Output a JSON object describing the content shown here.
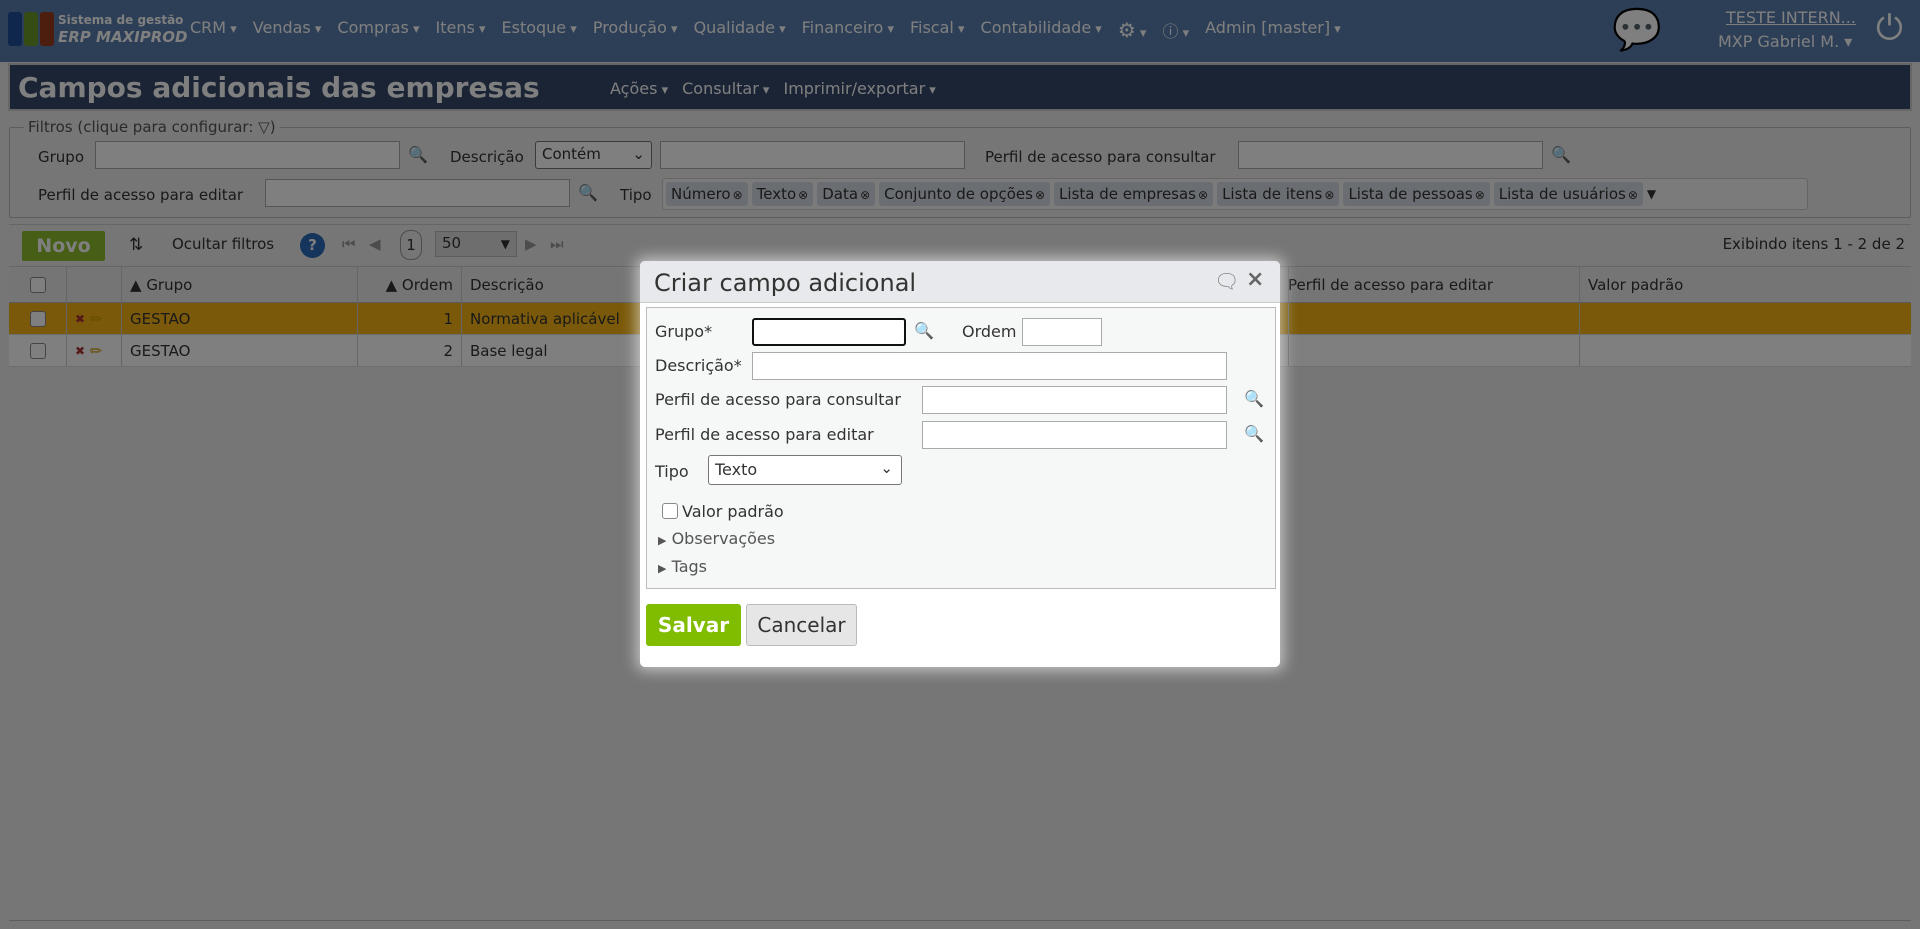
{
  "nav": {
    "brand_line1": "Sistema de gestão",
    "brand_line2": "ERP MAXIPROD",
    "menu": [
      "CRM",
      "Vendas",
      "Compras",
      "Itens",
      "Estoque",
      "Produção",
      "Qualidade",
      "Financeiro",
      "Fiscal",
      "Contabilidade"
    ],
    "user_menu": "Admin [master]",
    "company": "TESTE INTERN...",
    "user": "MXP Gabriel M."
  },
  "page": {
    "title": "Campos adicionais das empresas",
    "menu": [
      "Ações",
      "Consultar",
      "Imprimir/exportar"
    ]
  },
  "filters": {
    "legend": "Filtros (clique para configurar:",
    "legend_end": ")",
    "grupo": "Grupo",
    "descricao": "Descrição",
    "descricao_op": "Contém",
    "perfil_consultar": "Perfil de acesso para consultar",
    "perfil_editar": "Perfil de acesso para editar",
    "tipo": "Tipo",
    "tipos": [
      "Número",
      "Texto",
      "Data",
      "Conjunto de opções",
      "Lista de empresas",
      "Lista de itens",
      "Lista de pessoas",
      "Lista de usuários"
    ]
  },
  "toolbar": {
    "novo": "Novo",
    "ocultar": "Ocultar filtros",
    "page": "1",
    "page_size": "50",
    "showing": "Exibindo itens 1 - 2 de 2"
  },
  "table": {
    "headers": {
      "grupo": "Grupo",
      "ordem": "Ordem",
      "descricao": "Descrição",
      "perfil_editar": "Perfil de acesso para editar",
      "valor_padrao": "Valor padrão"
    },
    "rows": [
      {
        "grupo": "GESTAO",
        "ordem": "1",
        "descricao": "Normativa aplicável",
        "selected": true
      },
      {
        "grupo": "GESTAO",
        "ordem": "2",
        "descricao": "Base legal",
        "selected": false
      }
    ]
  },
  "dialog": {
    "title": "Criar campo adicional",
    "grupo": "Grupo*",
    "ordem": "Ordem",
    "descricao": "Descrição*",
    "perfil_consultar": "Perfil de acesso para consultar",
    "perfil_editar": "Perfil de acesso para editar",
    "tipo": "Tipo",
    "tipo_value": "Texto",
    "valor_padrao": "Valor padrão",
    "observacoes": "Observações",
    "tags": "Tags",
    "salvar": "Salvar",
    "cancelar": "Cancelar"
  },
  "colors": {
    "nav": "#5b7fae",
    "title": "#36496a",
    "selected_row": "#f4b414",
    "save": "#8cbc2c"
  }
}
